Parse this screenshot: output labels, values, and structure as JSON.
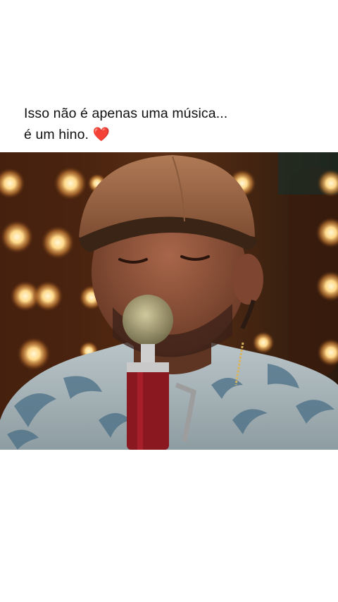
{
  "post": {
    "caption_line1": "Isso não é apenas uma música...",
    "caption_line2": "é um hino. ",
    "caption_emoji": "❤️"
  },
  "video": {
    "description_icon": "singer-with-microphone-frame"
  },
  "colors": {
    "background": "#ffffff",
    "caption_text": "#111111",
    "heart": "#e0112b"
  }
}
